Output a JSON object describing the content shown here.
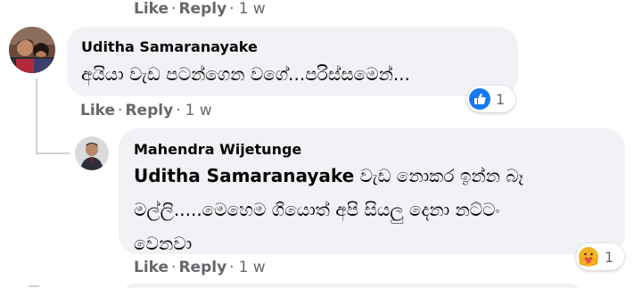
{
  "top_actions": {
    "like": "Like",
    "reply": "Reply",
    "sep": "·",
    "time": "1 w"
  },
  "comment": {
    "author": "Uditha Samaranayake",
    "text": "අයියා වැඩ පටන්ගෙන වගේ...පරිස්සමෙන්...",
    "reaction": {
      "type": "like",
      "count": "1",
      "color": "#1877f2"
    },
    "actions": {
      "like": "Like",
      "reply": "Reply",
      "sep": "·",
      "time": "1 w"
    }
  },
  "reply": {
    "author": "Mahendra Wijetunge",
    "mention": "Uditha Samaranayake",
    "line1_rest": " වැඩ නොකර ඉන්න බෑ",
    "line2": "මල්ලි.....මෙහෙම ගියොත් අපි සියලු දෙනා නට්ටං",
    "line3": "වෙනවා",
    "reaction": {
      "type": "care",
      "count": "1",
      "color": "#f7b125"
    },
    "actions": {
      "like": "Like",
      "reply": "Reply",
      "sep": "·",
      "time": "1 w"
    }
  },
  "colors": {
    "bubble": "#f0f2f5",
    "meta": "#65676b",
    "text": "#050505"
  }
}
